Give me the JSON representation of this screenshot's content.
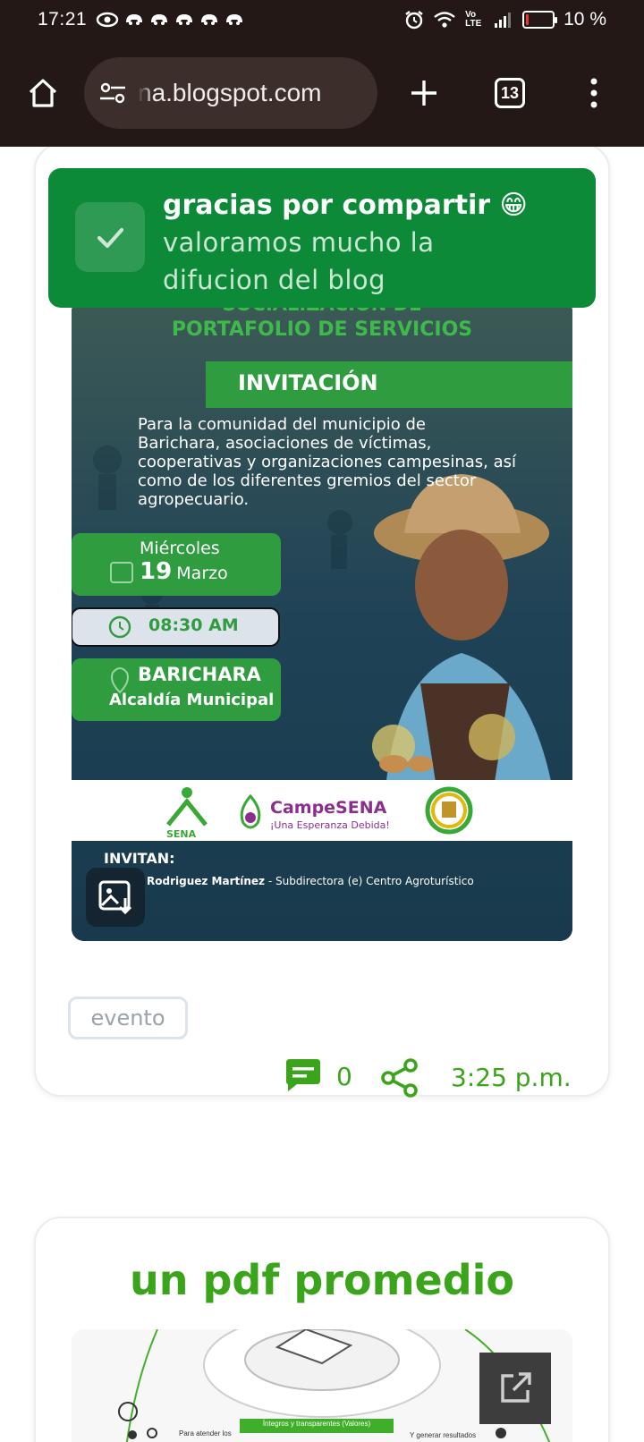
{
  "status": {
    "time": "17:21",
    "network_label": "Vo LTE",
    "battery_text": "10 %",
    "battery_level_percent": 10
  },
  "browser": {
    "url": "na.blogspot.com",
    "tab_count": "13"
  },
  "toast": {
    "title": "gracias por compartir 😁",
    "line2": "valoramos mucho la",
    "line3": "difucion del blog"
  },
  "poster": {
    "heading1": "SOCIALIZACIÓN DE",
    "heading2": "PORTAFOLIO DE SERVICIOS",
    "invitation": "INVITACIÓN",
    "body": [
      "Para la comunidad del municipio de",
      "Barichara, asociaciones de víctimas,",
      "cooperativas y organizaciones campesinas, así",
      "como de los diferentes gremios del sector",
      "agropecuario."
    ],
    "weekday": "Miércoles",
    "day": "19",
    "month": "Marzo",
    "time": "08:30 AM",
    "place": "BARICHARA",
    "place_sub": "Alcaldía Municipal",
    "sena_logo": "SENA",
    "campesena_name": "CampeSENA",
    "campesena_tagline": "¡Una Esperanza Debida!",
    "invitan": "INVITAN:",
    "invitan_name": "Rodriguez Martínez",
    "invitan_role": " - Subdirectora (e) Centro Agroturístico"
  },
  "post": {
    "tag": "evento",
    "comment_count": "0",
    "time": "3:25 p.m."
  },
  "next_post": {
    "title": "un pdf promedio",
    "preview_label_center": "Íntegros y transparentes (Valores)",
    "preview_label_left": "Para atender los",
    "preview_label_right": "Y generar resultados"
  },
  "colors": {
    "chrome_bg": "#231816",
    "toast_green": "#0d8a37",
    "accent_green": "#3aa51b",
    "poster_green": "#1f9a3a"
  }
}
